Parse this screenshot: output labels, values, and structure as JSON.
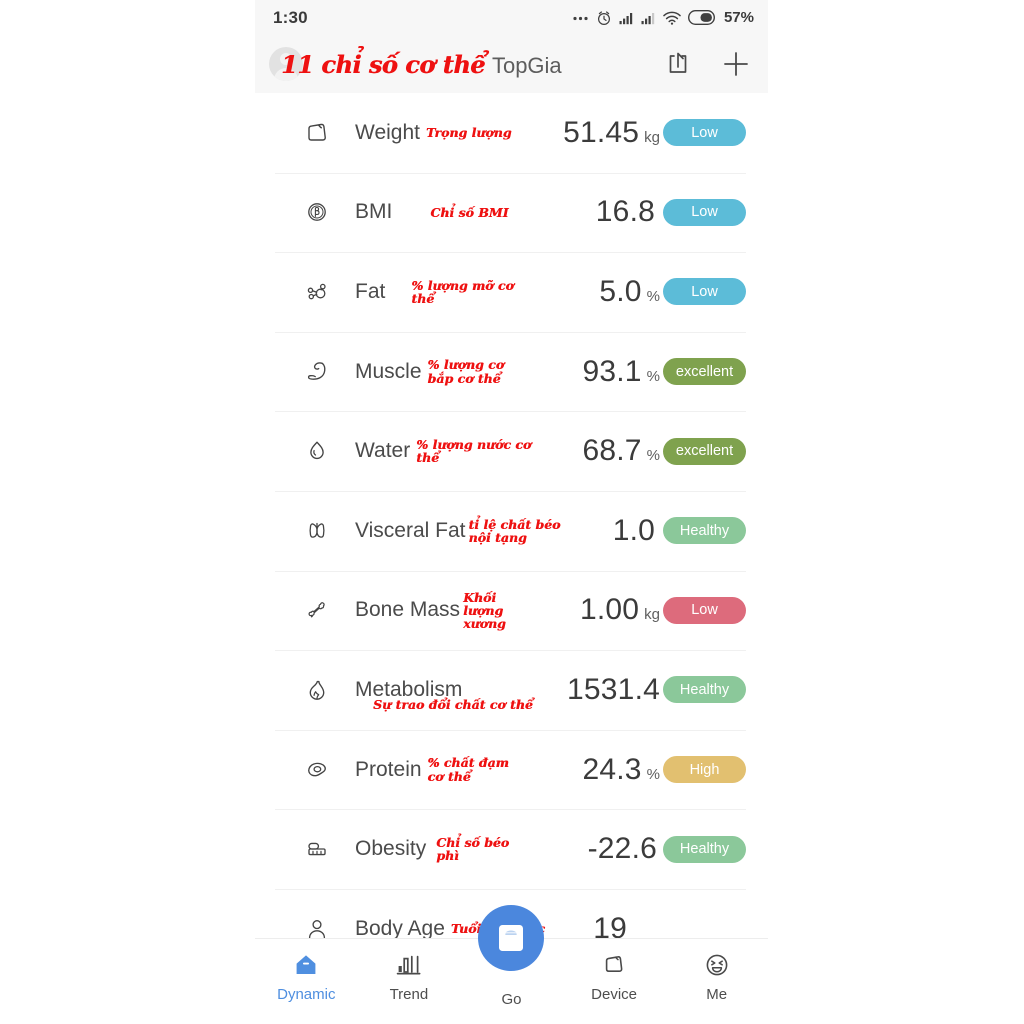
{
  "status_bar": {
    "time": "1:30",
    "battery_percent": "57%",
    "icons": [
      "more-dots-icon",
      "alarm-icon",
      "signal-1-icon",
      "signal-2-icon",
      "wifi-icon",
      "battery-icon"
    ]
  },
  "app_bar": {
    "overlay_title": "11 chỉ số cơ thể",
    "app_title": "TopGia",
    "share_label": "share-icon",
    "add_label": "add-icon"
  },
  "metrics": [
    {
      "icon": "scale-icon",
      "label": "Weight",
      "note": "Trọng lượng",
      "value": "51.45",
      "unit": "kg",
      "badge": "Low",
      "badge_color": "#5cbcd8"
    },
    {
      "icon": "bmi-icon",
      "label": "BMI",
      "note": "Chỉ số BMI",
      "value": "16.8",
      "unit": "",
      "badge": "Low",
      "badge_color": "#5cbcd8"
    },
    {
      "icon": "molecule-icon",
      "label": "Fat",
      "note": "% lượng mỡ cơ thể",
      "value": "5.0",
      "unit": "%",
      "badge": "Low",
      "badge_color": "#5cbcd8"
    },
    {
      "icon": "bicep-icon",
      "label": "Muscle",
      "note": "% lượng cơ bắp cơ thể",
      "value": "93.1",
      "unit": "%",
      "badge": "excellent",
      "badge_color": "#7fa24e"
    },
    {
      "icon": "water-drop-icon",
      "label": "Water",
      "note": "% lượng nước cơ thể",
      "value": "68.7",
      "unit": "%",
      "badge": "excellent",
      "badge_color": "#7fa24e"
    },
    {
      "icon": "organs-icon",
      "label": "Visceral Fat",
      "note": "tỉ lệ chất béo nội tạng",
      "value": "1.0",
      "unit": "",
      "badge": "Healthy",
      "badge_color": "#8bc89a"
    },
    {
      "icon": "bone-icon",
      "label": "Bone Mass",
      "note": "Khối lượng xương",
      "value": "1.00",
      "unit": "kg",
      "badge": "Low",
      "badge_color": "#dd6b7c"
    },
    {
      "icon": "flame-icon",
      "label": "Metabolism",
      "note": "Sự trao đổi chất cơ thể",
      "value": "1531.4",
      "unit": "",
      "badge": "Healthy",
      "badge_color": "#8bc89a"
    },
    {
      "icon": "egg-icon",
      "label": "Protein",
      "note": "% chất đạm cơ thể",
      "value": "24.3",
      "unit": "%",
      "badge": "High",
      "badge_color": "#e2c070"
    },
    {
      "icon": "belly-icon",
      "label": "Obesity",
      "note": "Chỉ số béo phì",
      "value": "-22.6",
      "unit": "",
      "badge": "Healthy",
      "badge_color": "#8bc89a"
    },
    {
      "icon": "person-icon",
      "label": "Body Age",
      "note": "Tuổi sinh học",
      "value": "19",
      "unit": "",
      "badge": "",
      "badge_color": ""
    }
  ],
  "bottom_nav": {
    "items": [
      {
        "label": "Dynamic",
        "icon": "home-icon",
        "active": true
      },
      {
        "label": "Trend",
        "icon": "chart-icon",
        "active": false
      },
      {
        "label": "Go",
        "icon": "scale-icon",
        "active": false
      },
      {
        "label": "Device",
        "icon": "device-icon",
        "active": false
      },
      {
        "label": "Me",
        "icon": "smiley-icon",
        "active": false
      }
    ]
  },
  "theme": {
    "accent_blue": "#4b87dd",
    "annotation_red": "#ee1111"
  }
}
